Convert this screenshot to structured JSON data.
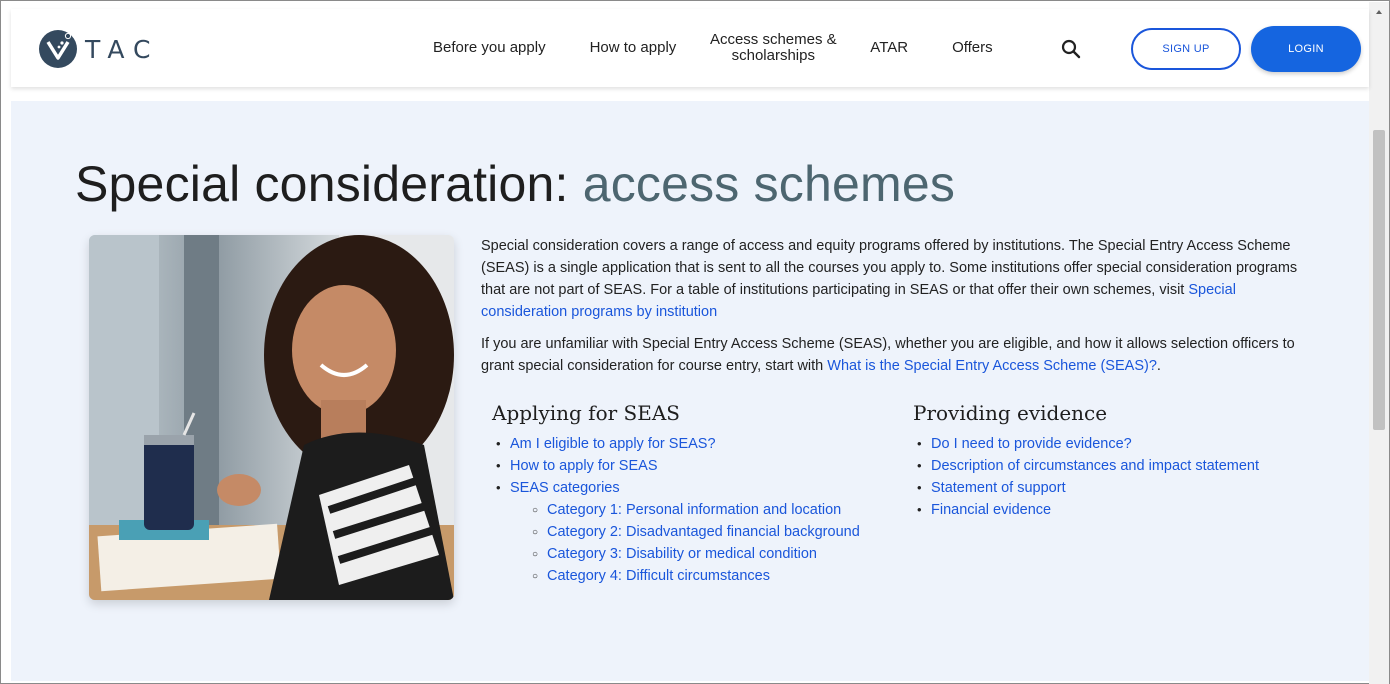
{
  "header": {
    "logo_text": "TAC",
    "nav": [
      {
        "label": "Before you apply"
      },
      {
        "label": "How to apply"
      },
      {
        "label": "Access schemes & scholarships"
      },
      {
        "label": "ATAR"
      },
      {
        "label": "Offers"
      }
    ],
    "signup_label": "SIGN UP",
    "login_label": "LOGIN"
  },
  "main": {
    "title_prefix": "Special consideration: ",
    "title_accent": "access schemes",
    "intro1_text": "Special consideration covers a range of access and equity programs offered by institutions. The Special Entry Access Scheme (SEAS) is a single application that is sent to all the courses you apply to. Some institutions offer special consideration programs that are not part of SEAS. For a table of institutions participating in SEAS or that offer their own schemes, visit ",
    "intro1_link": "Special consideration programs by institution",
    "intro2_text": "If you are unfamiliar with Special Entry Access Scheme (SEAS), whether you are eligible, and how it allows selection officers to grant special consideration for course entry, start with ",
    "intro2_link": "What is the Special Entry Access Scheme (SEAS)?",
    "intro2_end": ".",
    "applying": {
      "heading": "Applying for SEAS",
      "links": [
        "Am I eligible to apply for SEAS?",
        "How to apply for SEAS",
        "SEAS categories"
      ],
      "sublinks": [
        "Category 1: Personal information and location",
        "Category 2: Disadvantaged financial background",
        "Category 3: Disability or medical condition",
        "Category 4: Difficult circumstances"
      ]
    },
    "evidence": {
      "heading": "Providing evidence",
      "links": [
        "Do I need to provide evidence?",
        "Description of circumstances and impact statement",
        "Statement of support",
        "Financial evidence"
      ]
    }
  },
  "colors": {
    "link": "#1a56db",
    "login_bg": "#1565e0",
    "page_bg": "#eef3fb",
    "title_accent": "#4d6670",
    "logo": "#34495e"
  },
  "icons": {
    "logo": "vtac-logo-icon",
    "search": "search-icon"
  }
}
